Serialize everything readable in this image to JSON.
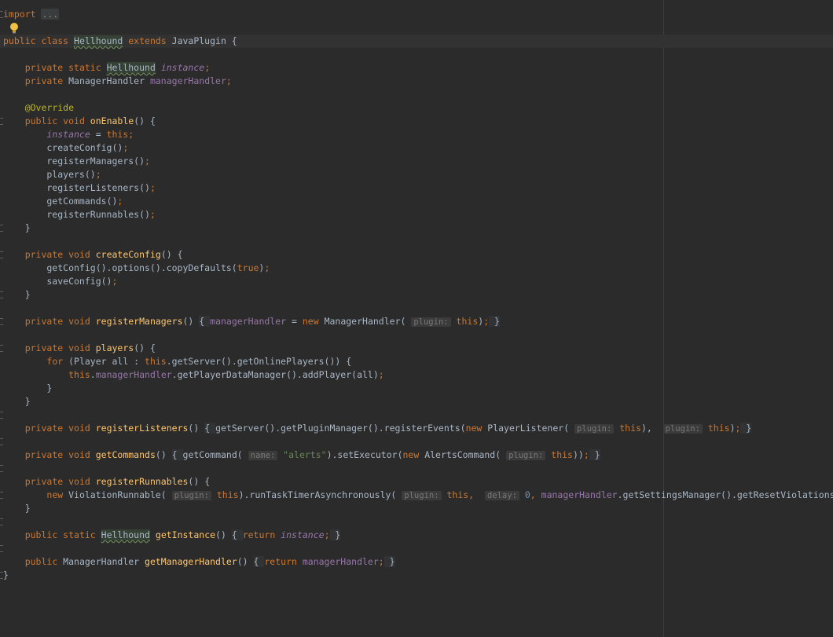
{
  "editor": {
    "language": "java",
    "lines": [
      {
        "t": "import",
        "tokens": [
          {
            "c": "kw",
            "v": "import"
          },
          {
            "c": "txt",
            "v": " "
          },
          {
            "c": "collapsed",
            "v": "..."
          }
        ]
      },
      {
        "t": "class",
        "tokens": [
          {
            "c": "kw",
            "v": "public class "
          },
          {
            "c": "caret",
            "v": ""
          },
          {
            "c": "hl",
            "v": "Hellhound"
          },
          {
            "c": "kw",
            "v": " extends "
          },
          {
            "c": "txt",
            "v": "JavaPlugin {"
          }
        ]
      },
      {
        "t": "blank",
        "tokens": []
      },
      {
        "t": "field1",
        "tokens": [
          {
            "c": "txt",
            "v": "    "
          },
          {
            "c": "kw",
            "v": "private static "
          },
          {
            "c": "hl",
            "v": "Hellhound"
          },
          {
            "c": "txt",
            "v": " "
          },
          {
            "c": "sfld",
            "v": "instance"
          },
          {
            "c": "kw",
            "v": ";"
          }
        ]
      },
      {
        "t": "field2",
        "tokens": [
          {
            "c": "txt",
            "v": "    "
          },
          {
            "c": "kw",
            "v": "private "
          },
          {
            "c": "txt",
            "v": "ManagerHandler "
          },
          {
            "c": "fld",
            "v": "managerHandler"
          },
          {
            "c": "kw",
            "v": ";"
          }
        ]
      },
      {
        "t": "blank",
        "tokens": []
      },
      {
        "t": "ann",
        "tokens": [
          {
            "c": "txt",
            "v": "    "
          },
          {
            "c": "ann",
            "v": "@Override"
          }
        ]
      },
      {
        "t": "m",
        "tokens": [
          {
            "c": "txt",
            "v": "    "
          },
          {
            "c": "kw",
            "v": "public void "
          },
          {
            "c": "fn",
            "v": "onEnable"
          },
          {
            "c": "txt",
            "v": "() {"
          }
        ]
      },
      {
        "t": "b",
        "tokens": [
          {
            "c": "txt",
            "v": "        "
          },
          {
            "c": "sfld",
            "v": "instance"
          },
          {
            "c": "txt",
            "v": " = "
          },
          {
            "c": "kw",
            "v": "this;"
          }
        ]
      },
      {
        "t": "b",
        "tokens": [
          {
            "c": "txt",
            "v": "        createConfig()"
          },
          {
            "c": "kw",
            "v": ";"
          }
        ]
      },
      {
        "t": "b",
        "tokens": [
          {
            "c": "txt",
            "v": "        registerManagers()"
          },
          {
            "c": "kw",
            "v": ";"
          }
        ]
      },
      {
        "t": "b",
        "tokens": [
          {
            "c": "txt",
            "v": "        players()"
          },
          {
            "c": "kw",
            "v": ";"
          }
        ]
      },
      {
        "t": "b",
        "tokens": [
          {
            "c": "txt",
            "v": "        registerListeners()"
          },
          {
            "c": "kw",
            "v": ";"
          }
        ]
      },
      {
        "t": "b",
        "tokens": [
          {
            "c": "txt",
            "v": "        getCommands()"
          },
          {
            "c": "kw",
            "v": ";"
          }
        ]
      },
      {
        "t": "b",
        "tokens": [
          {
            "c": "txt",
            "v": "        registerRunnables()"
          },
          {
            "c": "kw",
            "v": ";"
          }
        ]
      },
      {
        "t": "e",
        "tokens": [
          {
            "c": "txt",
            "v": "    }"
          }
        ]
      },
      {
        "t": "blank",
        "tokens": []
      },
      {
        "t": "m",
        "tokens": [
          {
            "c": "txt",
            "v": "    "
          },
          {
            "c": "kw",
            "v": "private void "
          },
          {
            "c": "fn",
            "v": "createConfig"
          },
          {
            "c": "txt",
            "v": "() {"
          }
        ]
      },
      {
        "t": "b",
        "tokens": [
          {
            "c": "txt",
            "v": "        getConfig().options().copyDefaults("
          },
          {
            "c": "kw",
            "v": "true"
          },
          {
            "c": "txt",
            "v": ")"
          },
          {
            "c": "kw",
            "v": ";"
          }
        ]
      },
      {
        "t": "b",
        "tokens": [
          {
            "c": "txt",
            "v": "        saveConfig()"
          },
          {
            "c": "kw",
            "v": ";"
          }
        ]
      },
      {
        "t": "e",
        "tokens": [
          {
            "c": "txt",
            "v": "    }"
          }
        ]
      },
      {
        "t": "blank",
        "tokens": []
      },
      {
        "t": "m",
        "tokens": [
          {
            "c": "txt",
            "v": "    "
          },
          {
            "c": "kw",
            "v": "private void "
          },
          {
            "c": "fn",
            "v": "registerManagers"
          },
          {
            "c": "txt",
            "v": "() "
          },
          {
            "c": "fold-body",
            "v": "{ "
          },
          {
            "c": "fld",
            "v": "managerHandler"
          },
          {
            "c": "txt",
            "v": " = "
          },
          {
            "c": "kw",
            "v": "new "
          },
          {
            "c": "txt",
            "v": "ManagerHandler( "
          },
          {
            "c": "hint",
            "v": "plugin:"
          },
          {
            "c": "txt",
            "v": " "
          },
          {
            "c": "kw",
            "v": "this"
          },
          {
            "c": "txt",
            "v": ")"
          },
          {
            "c": "kw",
            "v": ";"
          },
          {
            "c": "fold-body",
            "v": " }"
          }
        ]
      },
      {
        "t": "blank",
        "tokens": []
      },
      {
        "t": "m",
        "tokens": [
          {
            "c": "txt",
            "v": "    "
          },
          {
            "c": "kw",
            "v": "private void "
          },
          {
            "c": "fn",
            "v": "players"
          },
          {
            "c": "txt",
            "v": "() {"
          }
        ]
      },
      {
        "t": "b",
        "tokens": [
          {
            "c": "txt",
            "v": "        "
          },
          {
            "c": "kw",
            "v": "for "
          },
          {
            "c": "txt",
            "v": "(Player all : "
          },
          {
            "c": "kw",
            "v": "this"
          },
          {
            "c": "txt",
            "v": ".getServer().getOnlinePlayers()) {"
          }
        ]
      },
      {
        "t": "b",
        "tokens": [
          {
            "c": "txt",
            "v": "            "
          },
          {
            "c": "kw",
            "v": "this"
          },
          {
            "c": "txt",
            "v": "."
          },
          {
            "c": "fld",
            "v": "managerHandler"
          },
          {
            "c": "txt",
            "v": ".getPlayerDataManager().addPlayer(all)"
          },
          {
            "c": "kw",
            "v": ";"
          }
        ]
      },
      {
        "t": "b",
        "tokens": [
          {
            "c": "txt",
            "v": "        }"
          }
        ]
      },
      {
        "t": "e",
        "tokens": [
          {
            "c": "txt",
            "v": "    }"
          }
        ]
      },
      {
        "t": "blank",
        "tokens": []
      },
      {
        "t": "m",
        "tokens": [
          {
            "c": "txt",
            "v": "    "
          },
          {
            "c": "kw",
            "v": "private void "
          },
          {
            "c": "fn",
            "v": "registerListeners"
          },
          {
            "c": "txt",
            "v": "() "
          },
          {
            "c": "fold-body",
            "v": "{ "
          },
          {
            "c": "txt",
            "v": "getServer().getPluginManager().registerEvents("
          },
          {
            "c": "kw",
            "v": "new "
          },
          {
            "c": "txt",
            "v": "PlayerListener( "
          },
          {
            "c": "hint",
            "v": "plugin:"
          },
          {
            "c": "txt",
            "v": " "
          },
          {
            "c": "kw",
            "v": "this"
          },
          {
            "c": "txt",
            "v": "),  "
          },
          {
            "c": "hint",
            "v": "plugin:"
          },
          {
            "c": "txt",
            "v": " "
          },
          {
            "c": "kw",
            "v": "this"
          },
          {
            "c": "txt",
            "v": ")"
          },
          {
            "c": "kw",
            "v": ";"
          },
          {
            "c": "fold-body",
            "v": " }"
          }
        ]
      },
      {
        "t": "blank",
        "tokens": []
      },
      {
        "t": "m",
        "tokens": [
          {
            "c": "txt",
            "v": "    "
          },
          {
            "c": "kw",
            "v": "private void "
          },
          {
            "c": "fn",
            "v": "getCommands"
          },
          {
            "c": "txt",
            "v": "() "
          },
          {
            "c": "fold-body",
            "v": "{ "
          },
          {
            "c": "txt",
            "v": "getCommand( "
          },
          {
            "c": "hint",
            "v": "name:"
          },
          {
            "c": "txt",
            "v": " "
          },
          {
            "c": "str",
            "v": "\"alerts\""
          },
          {
            "c": "txt",
            "v": ").setExecutor("
          },
          {
            "c": "kw",
            "v": "new "
          },
          {
            "c": "txt",
            "v": "AlertsCommand( "
          },
          {
            "c": "hint",
            "v": "plugin:"
          },
          {
            "c": "txt",
            "v": " "
          },
          {
            "c": "kw",
            "v": "this"
          },
          {
            "c": "txt",
            "v": "))"
          },
          {
            "c": "kw",
            "v": ";"
          },
          {
            "c": "fold-body",
            "v": " }"
          }
        ]
      },
      {
        "t": "blank",
        "tokens": []
      },
      {
        "t": "m",
        "tokens": [
          {
            "c": "txt",
            "v": "    "
          },
          {
            "c": "kw",
            "v": "private void "
          },
          {
            "c": "fn",
            "v": "registerRunnables"
          },
          {
            "c": "txt",
            "v": "() {"
          }
        ]
      },
      {
        "t": "b",
        "tokens": [
          {
            "c": "txt",
            "v": "        "
          },
          {
            "c": "kw",
            "v": "new "
          },
          {
            "c": "txt",
            "v": "ViolationRunnable( "
          },
          {
            "c": "hint",
            "v": "plugin:"
          },
          {
            "c": "txt",
            "v": " "
          },
          {
            "c": "kw",
            "v": "this"
          },
          {
            "c": "txt",
            "v": ").runTaskTimerAsynchronously( "
          },
          {
            "c": "hint",
            "v": "plugin:"
          },
          {
            "c": "txt",
            "v": " "
          },
          {
            "c": "kw",
            "v": "this,"
          },
          {
            "c": "txt",
            "v": "  "
          },
          {
            "c": "hint",
            "v": "delay:"
          },
          {
            "c": "txt",
            "v": " "
          },
          {
            "c": "num",
            "v": "0"
          },
          {
            "c": "kw",
            "v": ","
          },
          {
            "c": "txt",
            "v": " "
          },
          {
            "c": "fld",
            "v": "managerHandler"
          },
          {
            "c": "txt",
            "v": ".getSettingsManager().getResetViolations())"
          },
          {
            "c": "kw",
            "v": ";"
          }
        ]
      },
      {
        "t": "e",
        "tokens": [
          {
            "c": "txt",
            "v": "    }"
          }
        ]
      },
      {
        "t": "blank",
        "tokens": []
      },
      {
        "t": "m",
        "tokens": [
          {
            "c": "txt",
            "v": "    "
          },
          {
            "c": "kw",
            "v": "public static "
          },
          {
            "c": "hl",
            "v": "Hellhound"
          },
          {
            "c": "txt",
            "v": " "
          },
          {
            "c": "fn",
            "v": "getInstance"
          },
          {
            "c": "txt",
            "v": "() "
          },
          {
            "c": "fold-body",
            "v": "{ "
          },
          {
            "c": "kw",
            "v": "return "
          },
          {
            "c": "sfld",
            "v": "instance"
          },
          {
            "c": "kw",
            "v": ";"
          },
          {
            "c": "fold-body",
            "v": " }"
          }
        ]
      },
      {
        "t": "blank",
        "tokens": []
      },
      {
        "t": "m",
        "tokens": [
          {
            "c": "txt",
            "v": "    "
          },
          {
            "c": "kw",
            "v": "public "
          },
          {
            "c": "txt",
            "v": "ManagerHandler "
          },
          {
            "c": "fn",
            "v": "getManagerHandler"
          },
          {
            "c": "txt",
            "v": "() "
          },
          {
            "c": "fold-body",
            "v": "{ "
          },
          {
            "c": "kw",
            "v": "return "
          },
          {
            "c": "fld",
            "v": "managerHandler"
          },
          {
            "c": "kw",
            "v": ";"
          },
          {
            "c": "fold-body",
            "v": " }"
          }
        ]
      },
      {
        "t": "end",
        "tokens": [
          {
            "c": "txt",
            "v": "}"
          }
        ]
      }
    ],
    "fold_markers": [
      0,
      7,
      15,
      17,
      20,
      22,
      24,
      29,
      31,
      33,
      35,
      37,
      39,
      41,
      43
    ]
  }
}
